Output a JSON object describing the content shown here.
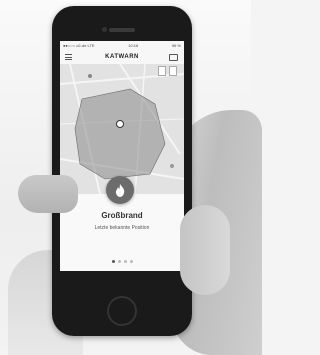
{
  "statusbar": {
    "carrier": "●●○○○ o2-de LTE",
    "time": "10:16",
    "battery": "96 %"
  },
  "navbar": {
    "title": "KATWARN",
    "menu_icon": "hamburger-icon",
    "right_icon": "chat-icon"
  },
  "map": {
    "layer_icons": [
      "layers-icon",
      "list-icon"
    ],
    "marker_icon": "location-marker-icon"
  },
  "event": {
    "icon": "flame-icon",
    "title": "Großbrand",
    "subtitle": "Letzte bekannte Position"
  },
  "pager": {
    "count": 4,
    "active_index": 0
  },
  "colors": {
    "accent_zone": "#8a8a8a",
    "fire_button": "#6c6c6c"
  }
}
